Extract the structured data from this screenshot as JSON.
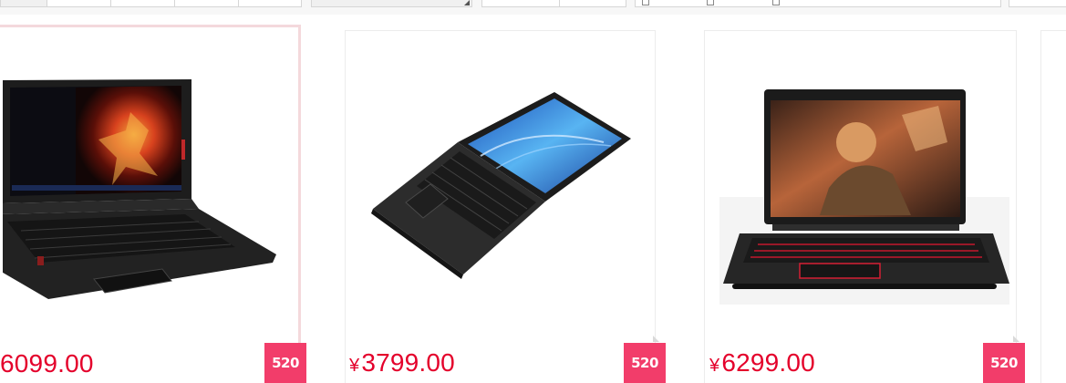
{
  "colors": {
    "price": "#e4002b",
    "badge_bg": "#f23d6a",
    "active_border": "#f4d9dc",
    "card_border": "#ececec"
  },
  "products": [
    {
      "price": "6099.00",
      "badge": "520",
      "image": "laptop-red-flame-wallpaper",
      "state": "hovered"
    },
    {
      "currency": "¥",
      "price": "3799.00",
      "badge": "520",
      "image": "laptop-open-tilted-blue-screen"
    },
    {
      "currency": "¥",
      "price": "6299.00",
      "badge": "520",
      "image": "gaming-laptop-red-keyboard"
    }
  ]
}
